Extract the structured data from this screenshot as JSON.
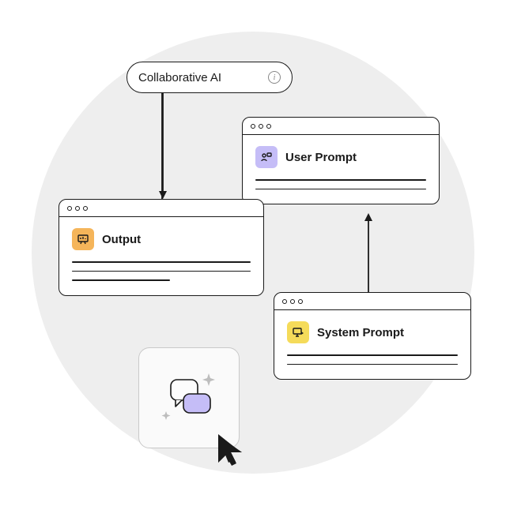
{
  "pill": {
    "label": "Collaborative AI"
  },
  "windows": {
    "output": {
      "title": "Output"
    },
    "userPrompt": {
      "title": "User Prompt"
    },
    "systemPrompt": {
      "title": "System Prompt"
    }
  },
  "colors": {
    "orange": "#f5b55a",
    "purple": "#c5bdf7",
    "yellow": "#f5db5a",
    "stroke": "#1a1a1a"
  }
}
